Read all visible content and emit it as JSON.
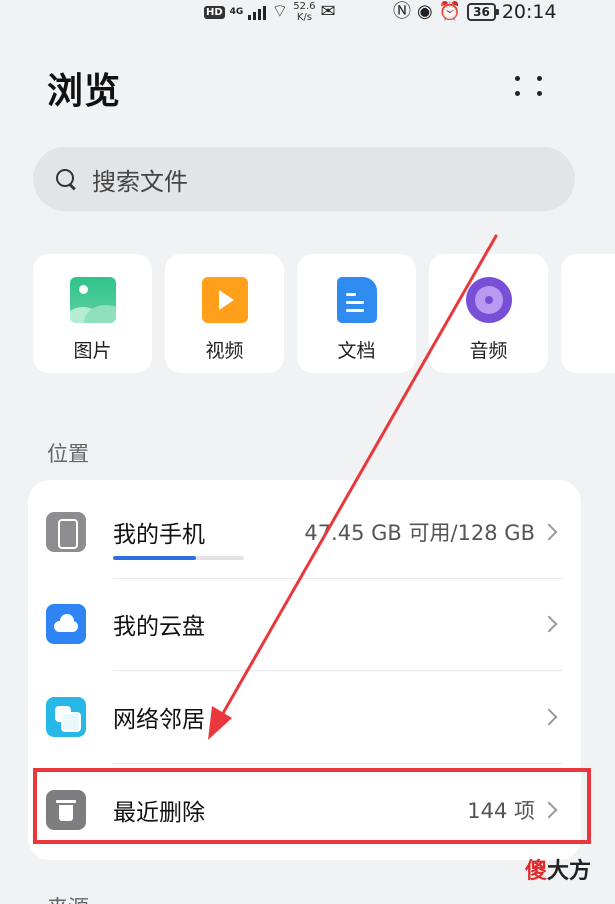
{
  "status_bar": {
    "hd": "HD",
    "network": "4G",
    "speed_value": "52.6",
    "speed_unit": "K/s",
    "battery": "36",
    "time": "20:14"
  },
  "header": {
    "title": "浏览"
  },
  "search": {
    "placeholder": "搜索文件"
  },
  "categories": [
    {
      "label": "图片",
      "icon": "image-icon"
    },
    {
      "label": "视频",
      "icon": "video-icon"
    },
    {
      "label": "文档",
      "icon": "document-icon"
    },
    {
      "label": "音频",
      "icon": "audio-icon"
    }
  ],
  "locations_section": {
    "title": "位置",
    "items": [
      {
        "label": "我的手机",
        "info": "47.45 GB 可用/128 GB",
        "icon": "phone-icon",
        "storage_used_fraction": 0.63
      },
      {
        "label": "我的云盘",
        "info": "",
        "icon": "cloud-icon"
      },
      {
        "label": "网络邻居",
        "info": "",
        "icon": "network-icon"
      },
      {
        "label": "最近删除",
        "info": "144 项",
        "icon": "trash-icon"
      }
    ]
  },
  "annotation": {
    "highlight_color": "#e8383c"
  },
  "watermark": {
    "part1": "傻",
    "part2": "大方"
  },
  "next_section": {
    "title": "来源"
  }
}
